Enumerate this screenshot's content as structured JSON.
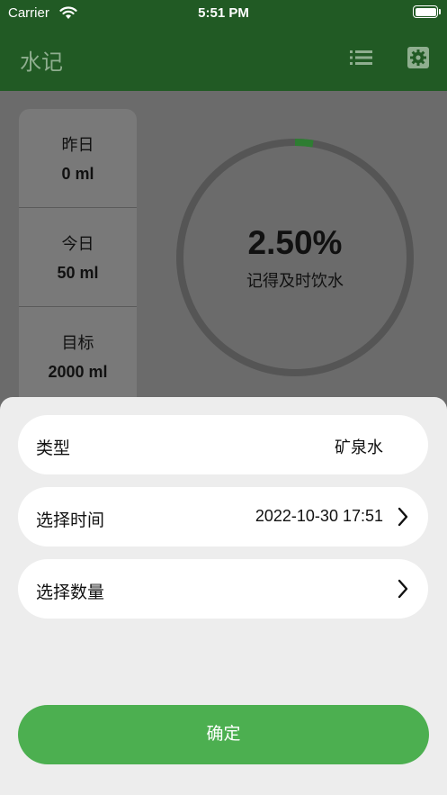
{
  "status_bar": {
    "carrier": "Carrier",
    "time": "5:51 PM"
  },
  "app_bar": {
    "title": "水记",
    "icons": [
      "list-icon",
      "gear-icon"
    ]
  },
  "stats": {
    "yesterday": {
      "label": "昨日",
      "value": "0 ml"
    },
    "today": {
      "label": "今日",
      "value": "50 ml"
    },
    "target": {
      "label": "目标",
      "value": "2000 ml"
    }
  },
  "progress": {
    "percent_text": "2.50%",
    "fraction": 0.025,
    "caption": "记得及时饮水"
  },
  "sheet": {
    "type_row": {
      "label": "类型",
      "value": "矿泉水"
    },
    "time_row": {
      "label": "选择时间",
      "value": "2022-10-30 17:51"
    },
    "amount_row": {
      "label": "选择数量",
      "value": ""
    },
    "confirm_label": "确定"
  },
  "colors": {
    "app_bar": "#215a24",
    "accent": "#4caf50",
    "ring_track": "#555555"
  }
}
